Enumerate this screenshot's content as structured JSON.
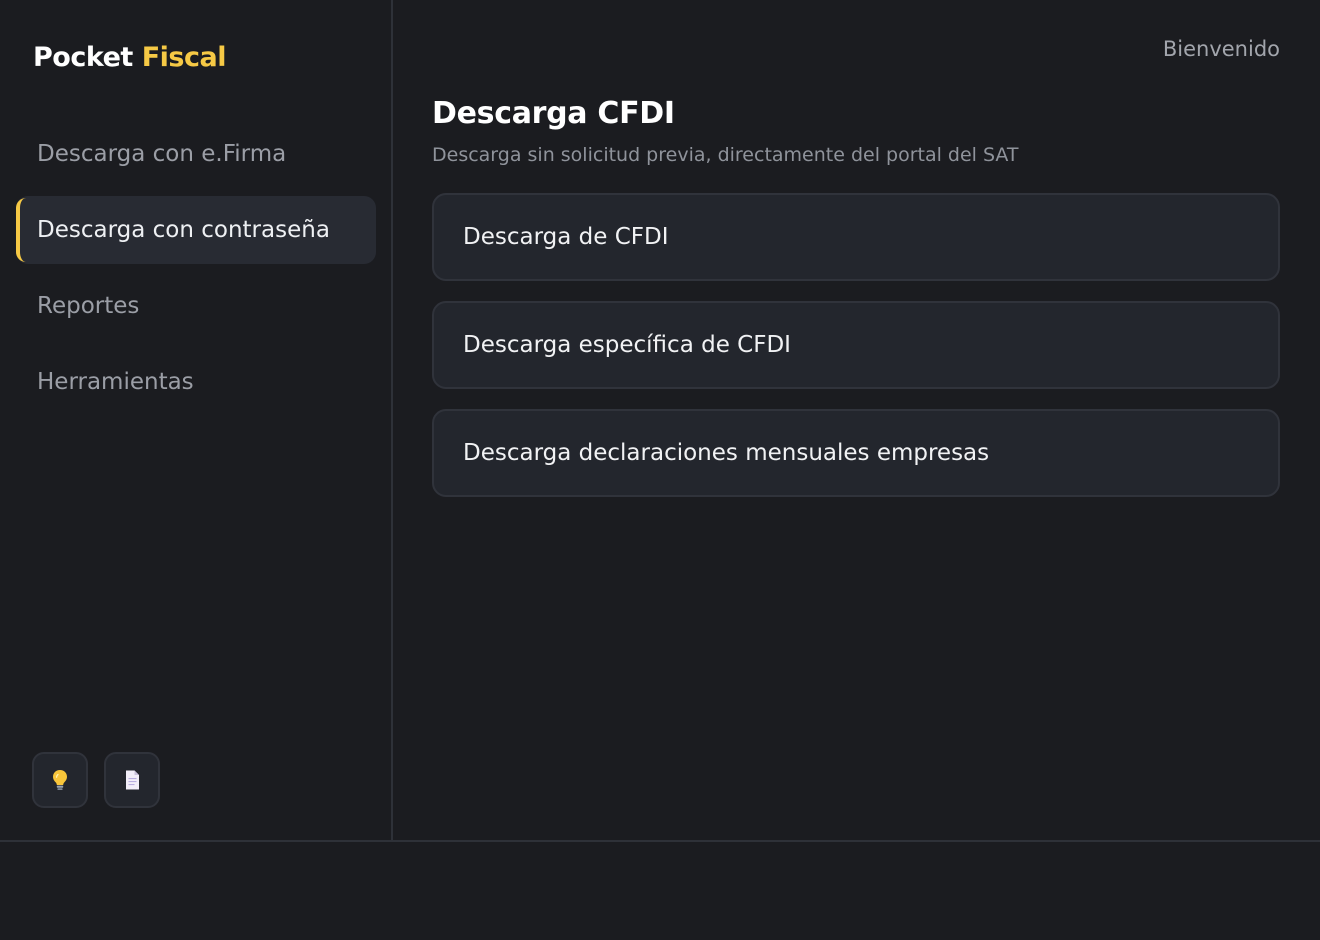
{
  "brand": {
    "part1": "Pocket",
    "part2": "Fiscal"
  },
  "sidebar": {
    "items": [
      {
        "label": "Descarga con e.Firma"
      },
      {
        "label": "Descarga con contraseña"
      },
      {
        "label": "Reportes"
      },
      {
        "label": "Herramientas"
      }
    ],
    "active_index": 1,
    "footer_buttons": [
      {
        "icon": "lightbulb-icon"
      },
      {
        "icon": "document-icon"
      }
    ]
  },
  "header": {
    "welcome": "Bienvenido"
  },
  "main": {
    "title": "Descarga CFDI",
    "subtitle": "Descarga sin solicitud previa, directamente del portal del SAT",
    "cards": [
      {
        "label": "Descarga de CFDI"
      },
      {
        "label": "Descarga específica de CFDI"
      },
      {
        "label": "Descarga declaraciones mensuales empresas"
      }
    ]
  },
  "colors": {
    "background": "#1b1c20",
    "accent": "#f6c945",
    "card": "#23262d",
    "active_nav": "#282b33"
  }
}
